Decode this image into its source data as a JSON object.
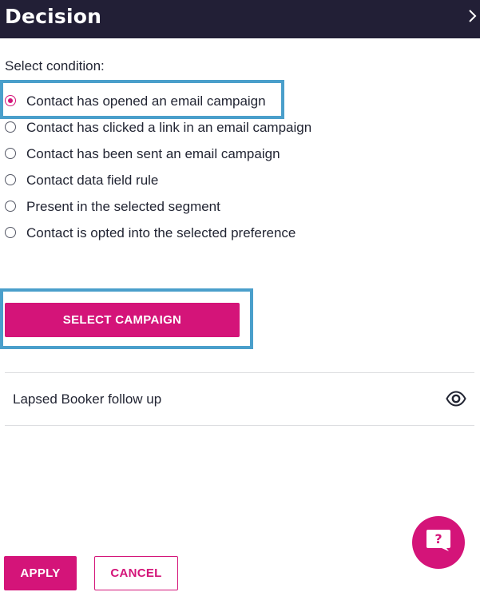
{
  "header": {
    "title": "Decision",
    "close_icon": "chevron-right-icon"
  },
  "condition": {
    "label": "Select condition:",
    "options": [
      {
        "label": "Contact has opened an email campaign",
        "selected": true
      },
      {
        "label": "Contact has clicked a link in an email campaign",
        "selected": false
      },
      {
        "label": "Contact has been sent an email campaign",
        "selected": false
      },
      {
        "label": "Contact data field rule",
        "selected": false
      },
      {
        "label": "Present in the selected segment",
        "selected": false
      },
      {
        "label": "Contact is opted into the selected preference",
        "selected": false
      }
    ]
  },
  "select_campaign": {
    "label": "SELECT CAMPAIGN"
  },
  "selected_campaign": {
    "name": "Lapsed Booker follow up",
    "preview_icon": "eye-icon"
  },
  "help": {
    "icon": "help-chat-icon",
    "glyph": "?"
  },
  "footer": {
    "apply_label": "APPLY",
    "cancel_label": "CANCEL"
  },
  "colors": {
    "header_bg": "#221f36",
    "accent": "#d41479",
    "highlight": "#4a9fcb"
  }
}
